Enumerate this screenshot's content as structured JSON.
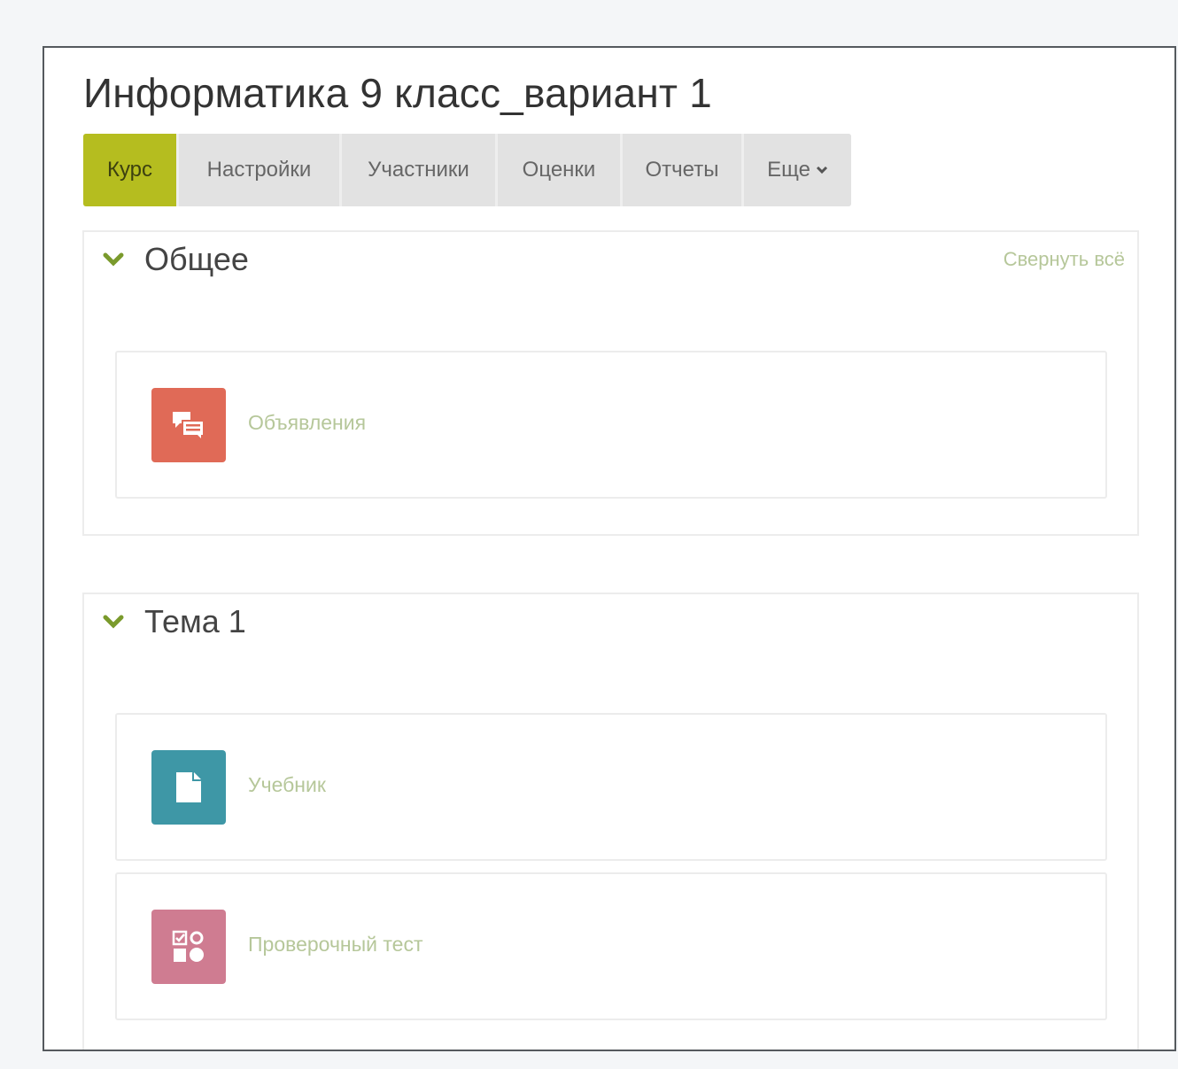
{
  "course": {
    "title": "Информатика 9 класс_вариант 1"
  },
  "tabs": [
    {
      "label": "Курс",
      "active": true
    },
    {
      "label": "Настройки"
    },
    {
      "label": "Участники"
    },
    {
      "label": "Оценки"
    },
    {
      "label": "Отчеты"
    },
    {
      "label": "Еще",
      "icon": "chevron-down-icon"
    }
  ],
  "collapse_all": "Свернуть всё",
  "sections": [
    {
      "title": "Общее",
      "activities": [
        {
          "name": "Объявления",
          "icon": "forum-icon",
          "color": "#e06a57"
        }
      ]
    },
    {
      "title": "Тема 1",
      "activities": [
        {
          "name": "Учебник",
          "icon": "file-icon",
          "color": "#3e97a6"
        },
        {
          "name": "Проверочный тест",
          "icon": "quiz-icon",
          "color": "#cf7c91"
        }
      ]
    }
  ],
  "colors": {
    "accent": "#b5bd1f",
    "link": "#b6c79a",
    "chevron": "#7a9a2c"
  }
}
